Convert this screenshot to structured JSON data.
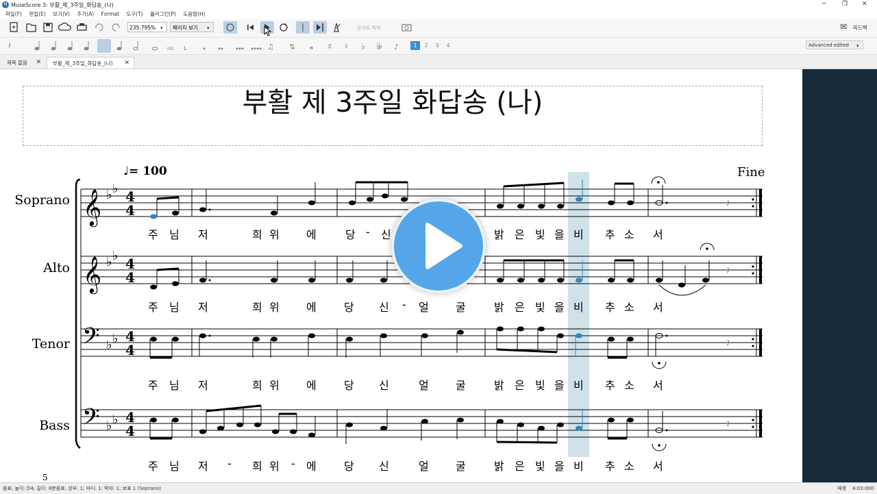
{
  "window": {
    "title": "MuseScore 3: 부활_제_3주일_화답송_(나)",
    "controls": [
      "─",
      "❐",
      "✕"
    ]
  },
  "menu": [
    "파일(F)",
    "편집(E)",
    "보기(V)",
    "추가(A)",
    "Format",
    "도구(T)",
    "플러그인(P)",
    "도움말(H)"
  ],
  "toolbar": {
    "zoom_value": "235.795%",
    "view_mode": "페이지 보기",
    "concert_pitch": "콘서트 피치",
    "feedback_label": "피드백"
  },
  "palette": {
    "voices": [
      "1",
      "2",
      "3",
      "4"
    ],
    "workspace": "Advanced edited"
  },
  "tabs": [
    {
      "label": "제목 없음",
      "active": false
    },
    {
      "label": "부활_제_3주일_화답송_(나)",
      "active": true
    }
  ],
  "score": {
    "title": "부활 제 3주일 화답송 (나)",
    "tempo_value": "= 100",
    "fine": "Fine",
    "page_number": "5",
    "instruments": [
      "Soprano",
      "Alto",
      "Tenor",
      "Bass"
    ],
    "lyrics": {
      "soprano": [
        "주",
        "님",
        "저",
        "희",
        "위",
        "에",
        "당",
        "-",
        "신",
        "밝",
        "은",
        "빛",
        "을",
        "비",
        "추",
        "소",
        "서"
      ],
      "alto": [
        "주",
        "님",
        "저",
        "희",
        "위",
        "에",
        "당",
        "신",
        "-",
        "얼",
        "굴",
        "밝",
        "은",
        "빛",
        "을",
        "비",
        "추",
        "소",
        "서"
      ],
      "tenor": [
        "주",
        "님",
        "저",
        "희",
        "위",
        "에",
        "당",
        "신",
        "얼",
        "굴",
        "밝",
        "은",
        "빛",
        "을",
        "비",
        "추",
        "소",
        "서"
      ],
      "bass": [
        "주",
        "님",
        "저",
        "-",
        "희",
        "위",
        "-",
        "에",
        "당",
        "신",
        "얼",
        "굴",
        "밝",
        "은",
        "빛",
        "을",
        "비",
        "추",
        "소",
        "서"
      ]
    }
  },
  "status": {
    "left": "음표; 높이: D4; 길이: 8분음표; 성부: 1; 마디: 1; 박자: 1; 보표 1 (Soprano)",
    "mode": "재생",
    "time": "4:03:000"
  },
  "colors": {
    "side_panel": "#172a39",
    "playback_highlight": "#cfe2ea",
    "selected_note": "#2e86c1",
    "play_button": "#55a6e9"
  }
}
